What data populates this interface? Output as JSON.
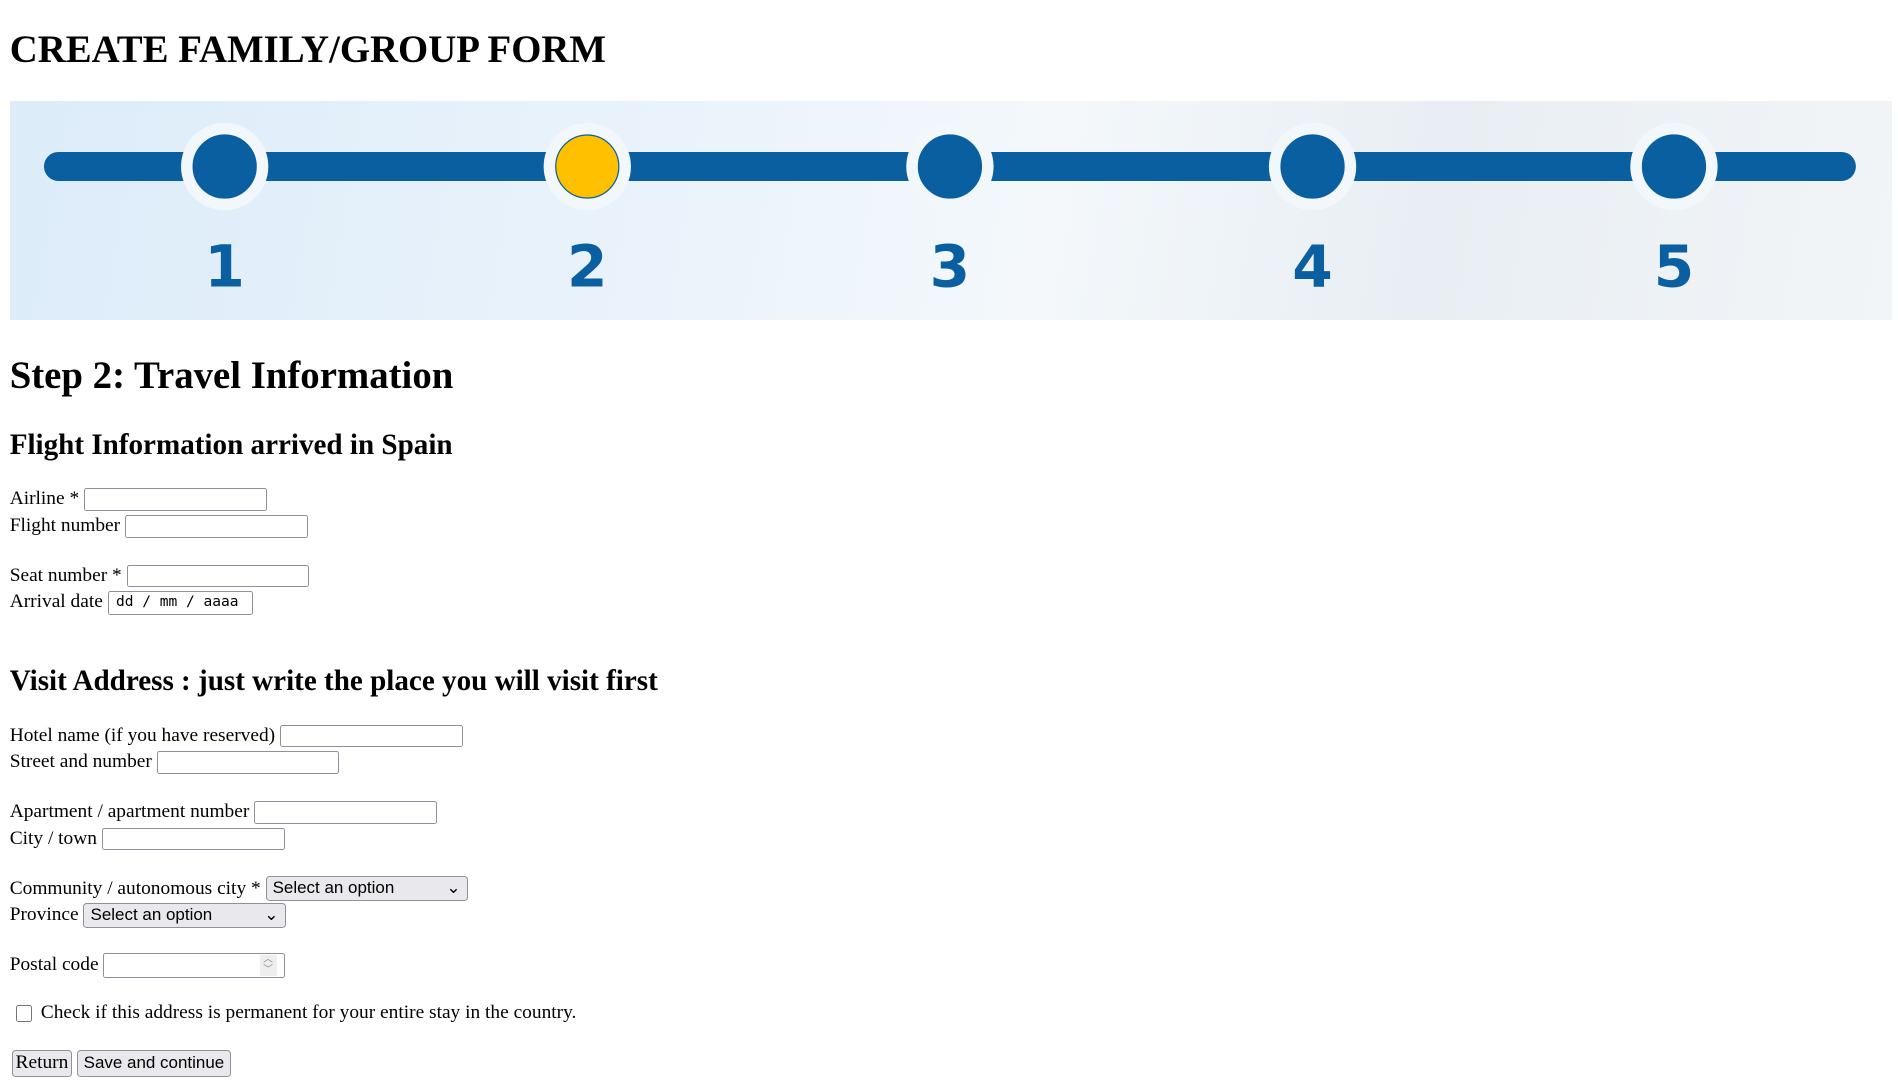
{
  "page_title": "CREATE FAMILY/GROUP FORM",
  "stepper": {
    "steps": [
      "1",
      "2",
      "3",
      "4",
      "5"
    ],
    "current": 2,
    "colors": {
      "step": "#0a5fa0",
      "current": "#ffc000",
      "number": "#0a5fa0"
    }
  },
  "step_title": "Step 2: Travel Information",
  "flight": {
    "heading": "Flight Information arrived in Spain",
    "airline_label": "Airline *",
    "flight_number_label": "Flight number",
    "seat_label": "Seat number *",
    "arrival_label": "Arrival date",
    "arrival_placeholder": "dd / mm / aaaa"
  },
  "address": {
    "heading": "Visit Address : just write the place you will visit first",
    "hotel_label": "Hotel name (if you have reserved)",
    "street_label": "Street and number",
    "apartment_label": "Apartment / apartment number",
    "city_label": "City / town",
    "community_label": "Community / autonomous city *",
    "community_value": "Select an option",
    "province_label": "Province",
    "province_value": "Select an option",
    "postal_label": "Postal code",
    "permanent_label": "Check if this address is permanent for your entire stay in the country."
  },
  "buttons": {
    "return": "Return",
    "save": "Save and continue"
  }
}
